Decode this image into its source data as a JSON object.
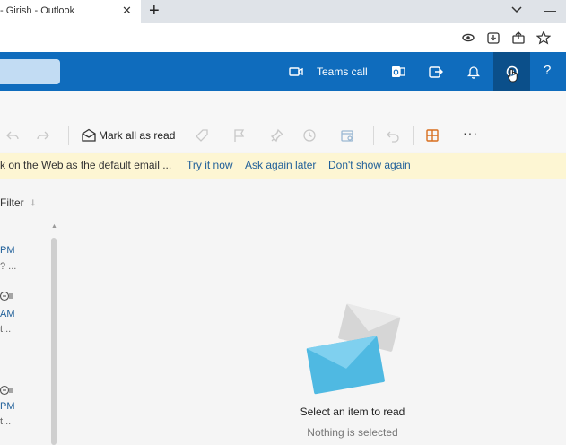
{
  "browser": {
    "tab_title": "- Girish - Outlook",
    "tab_close": "✕",
    "new_tab": "+",
    "minimize": "—"
  },
  "header": {
    "teams_call_label": "Teams call",
    "help_label": "?"
  },
  "toolbar": {
    "mark_all_read_label": "Mark all as read",
    "more_label": "···"
  },
  "banner": {
    "message": "k on the Web as the default email ...",
    "try_it_now": "Try it now",
    "ask_again_later": "Ask again later",
    "dont_show_again": "Don't show again"
  },
  "message_list": {
    "filter_label": "Filter",
    "filter_arrow": "↓",
    "items": [
      {
        "time": "PM",
        "snippet": "? ..."
      },
      {
        "time": "AM",
        "snippet": "t..."
      },
      {
        "time": "PM",
        "snippet": "t..."
      }
    ]
  },
  "reading_pane": {
    "title": "Select an item to read",
    "subtitle": "Nothing is selected"
  },
  "colors": {
    "header_blue": "#0f6cbd",
    "banner_yellow": "#fdf6d3",
    "link_blue": "#1f5f99"
  }
}
